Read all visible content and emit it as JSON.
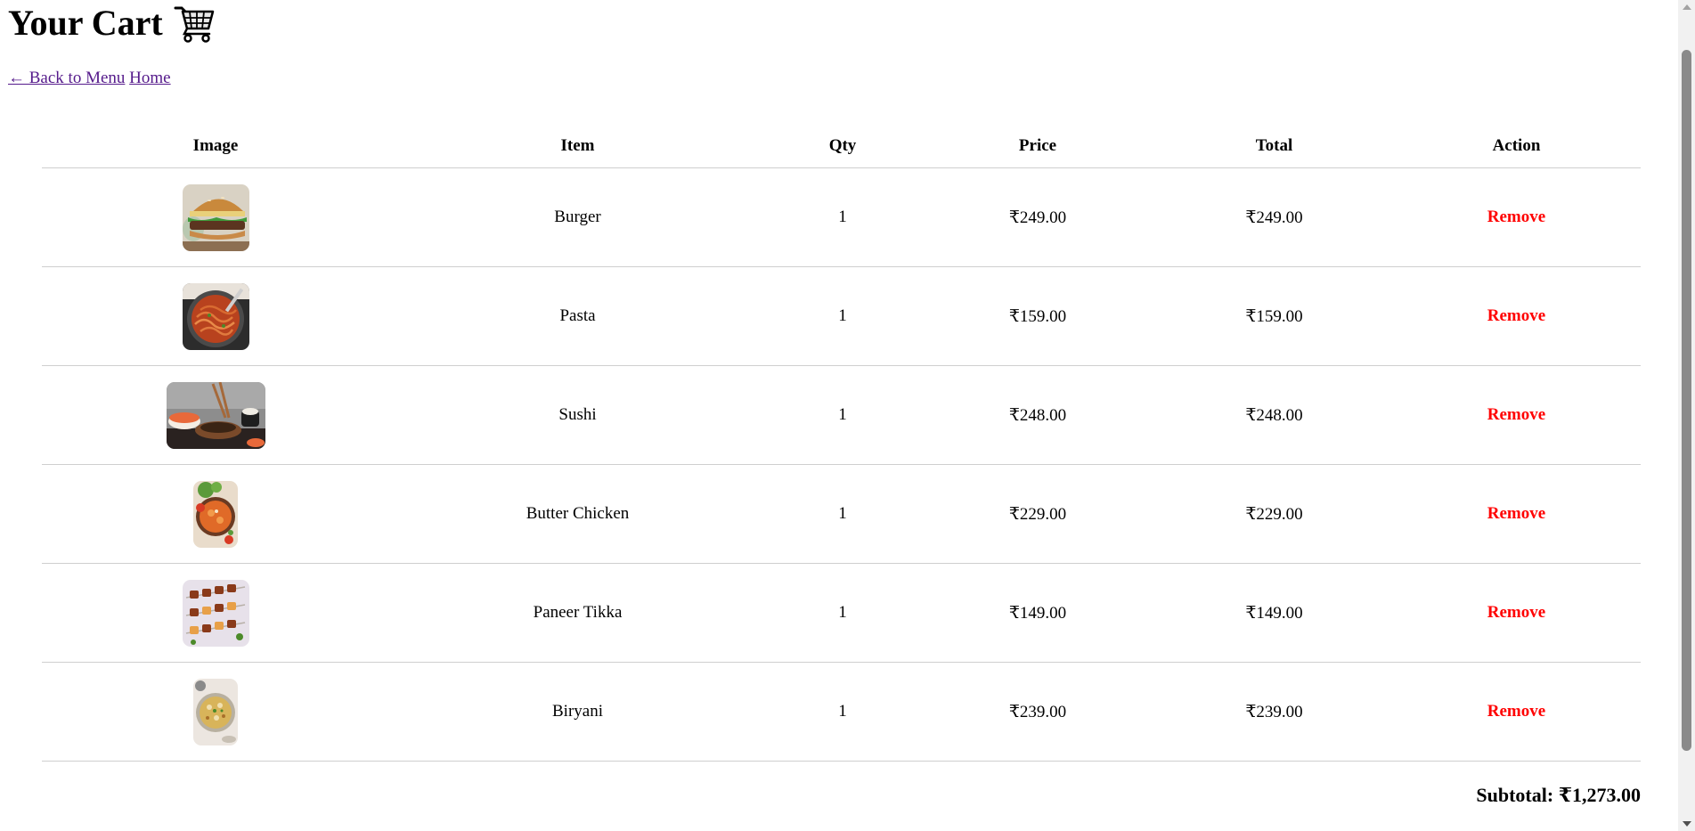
{
  "header": {
    "title": "Your Cart",
    "icon": "shopping-cart-icon"
  },
  "nav": {
    "back_label": "← Back to Menu",
    "home_label": "Home",
    "link_color": "#551a8b"
  },
  "table": {
    "columns": [
      "Image",
      "Item",
      "Qty",
      "Price",
      "Total",
      "Action"
    ],
    "rows": [
      {
        "item": "Burger",
        "qty": "1",
        "price": "₹249.00",
        "total": "₹249.00",
        "action": "Remove",
        "image_icon": "burger-image"
      },
      {
        "item": "Pasta",
        "qty": "1",
        "price": "₹159.00",
        "total": "₹159.00",
        "action": "Remove",
        "image_icon": "pasta-image"
      },
      {
        "item": "Sushi",
        "qty": "1",
        "price": "₹248.00",
        "total": "₹248.00",
        "action": "Remove",
        "image_icon": "sushi-image"
      },
      {
        "item": "Butter Chicken",
        "qty": "1",
        "price": "₹229.00",
        "total": "₹229.00",
        "action": "Remove",
        "image_icon": "butter-chicken-image"
      },
      {
        "item": "Paneer Tikka",
        "qty": "1",
        "price": "₹149.00",
        "total": "₹149.00",
        "action": "Remove",
        "image_icon": "paneer-tikka-image"
      },
      {
        "item": "Biryani",
        "qty": "1",
        "price": "₹239.00",
        "total": "₹239.00",
        "action": "Remove",
        "image_icon": "biryani-image"
      }
    ]
  },
  "summary": {
    "subtotal_text": "Subtotal: ₹1,273.00"
  },
  "colors": {
    "remove": "#ff0000",
    "divider": "#cfcfcf"
  }
}
